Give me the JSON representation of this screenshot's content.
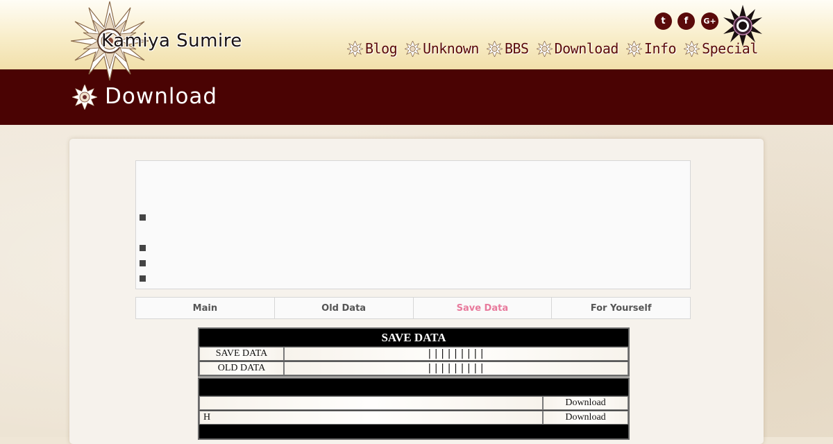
{
  "header": {
    "logo_text": "Kamiya Sumire",
    "social": {
      "twitter": "t",
      "facebook": "f",
      "google_plus": "G+"
    },
    "nav": [
      {
        "label": "Blog"
      },
      {
        "label": "Unknown"
      },
      {
        "label": "BBS"
      },
      {
        "label": "Download"
      },
      {
        "label": "Info"
      },
      {
        "label": "Special"
      }
    ]
  },
  "page": {
    "title": "Download"
  },
  "tabs": [
    {
      "label": "Main"
    },
    {
      "label": "Old Data"
    },
    {
      "label": "Save Data",
      "active": true
    },
    {
      "label": "For Yourself"
    }
  ],
  "save_table": {
    "heading": "SAVE DATA",
    "rows": [
      {
        "label": "SAVE DATA",
        "value": "|||||||||"
      },
      {
        "label": "OLD DATA",
        "value": "|||||||||"
      }
    ]
  },
  "download_table": {
    "rows": [
      {
        "name": "",
        "action": "Download"
      },
      {
        "name": "H",
        "action": "Download"
      }
    ]
  },
  "colors": {
    "brand_dark_red": "#4a0303",
    "nav_text": "#5a0a0a",
    "active_tab": "#e87a9c"
  },
  "icons": {
    "logo": "mandala-logo-icon",
    "nav_item": "flower-icon",
    "title": "flower-icon",
    "bullet": "square-bullet-icon"
  }
}
